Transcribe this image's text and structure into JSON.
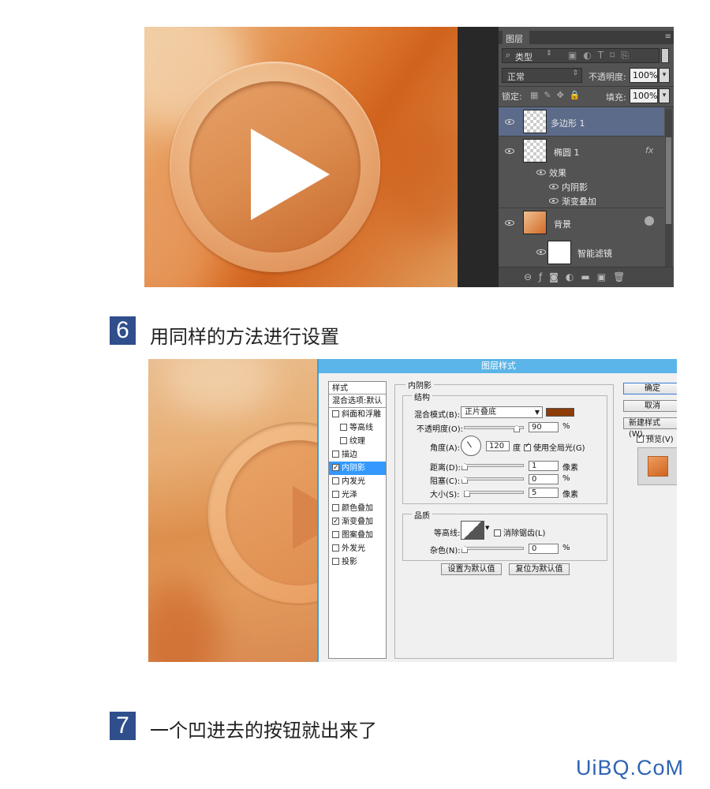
{
  "layers_panel": {
    "tab": "图层",
    "filter_kind": "类型",
    "blend_mode": "正常",
    "opacity_label": "不透明度:",
    "opacity_value": "100%",
    "lock_label": "锁定:",
    "fill_label": "填充:",
    "fill_value": "100%",
    "layers": [
      {
        "name": "多边形 1"
      },
      {
        "name": "椭圆 1",
        "fx": "fx"
      },
      {
        "name": "效果"
      },
      {
        "name": "内阴影"
      },
      {
        "name": "渐变叠加"
      },
      {
        "name": "背景"
      },
      {
        "name": "智能滤镜"
      }
    ],
    "bottom_icons": [
      "link-icon",
      "fx-icon",
      "mask-icon",
      "adjustment-icon",
      "folder-icon",
      "new-layer-icon",
      "trash-icon"
    ]
  },
  "step6": {
    "number": "6",
    "text": "用同样的方法进行设置"
  },
  "step7": {
    "number": "7",
    "text": "一个凹进去的按钮就出来了"
  },
  "layer_style_dialog": {
    "title": "图层样式",
    "styles_header": "样式",
    "styles": [
      {
        "label": "混合选项:默认",
        "checkbox": false
      },
      {
        "label": "斜面和浮雕",
        "checked": false
      },
      {
        "label": "等高线",
        "checked": false
      },
      {
        "label": "纹理",
        "checked": false
      },
      {
        "label": "描边",
        "checked": false
      },
      {
        "label": "内阴影",
        "checked": true,
        "selected": true
      },
      {
        "label": "内发光",
        "checked": false
      },
      {
        "label": "光泽",
        "checked": false
      },
      {
        "label": "颜色叠加",
        "checked": false
      },
      {
        "label": "渐变叠加",
        "checked": true
      },
      {
        "label": "图案叠加",
        "checked": false
      },
      {
        "label": "外发光",
        "checked": false
      },
      {
        "label": "投影",
        "checked": false
      }
    ],
    "section_title": "内阴影",
    "structure_title": "结构",
    "blend_mode_label": "混合模式(B):",
    "blend_mode_value": "正片叠底",
    "shadow_color": "#8e3c08",
    "opacity_label": "不透明度(O):",
    "opacity_value": "90",
    "percent": "%",
    "angle_label": "角度(A):",
    "angle_value": "120",
    "degree": "度",
    "global_light_label": "使用全局光(G)",
    "global_light_checked": true,
    "distance_label": "距离(D):",
    "distance_value": "1",
    "choke_label": "阻塞(C):",
    "choke_value": "0",
    "size_label": "大小(S):",
    "size_value": "5",
    "px": "像素",
    "quality_title": "品质",
    "contour_label": "等高线:",
    "antialias_label": "消除锯齿(L)",
    "noise_label": "杂色(N):",
    "noise_value": "0",
    "default_btn": "设置为默认值",
    "reset_btn": "复位为默认值",
    "ok_btn": "确定",
    "cancel_btn": "取消",
    "new_style_btn": "新建样式(W)...",
    "preview_label": "预览(V)",
    "preview_checked": true
  },
  "watermark": "UiBQ.CoM"
}
